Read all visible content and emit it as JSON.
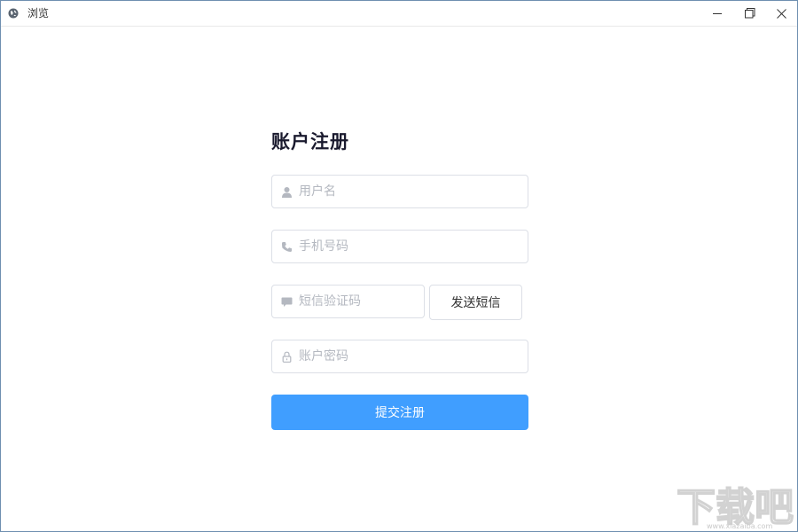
{
  "window": {
    "title": "浏览",
    "app_icon": "globe-icon",
    "controls": {
      "minimize_icon": "minimize-icon",
      "maximize_icon": "restore-icon",
      "close_icon": "close-icon"
    }
  },
  "form": {
    "title": "账户注册",
    "username": {
      "value": "",
      "placeholder": "用户名",
      "icon": "user-icon"
    },
    "phone": {
      "value": "",
      "placeholder": "手机号码",
      "icon": "phone-icon"
    },
    "sms_code": {
      "value": "",
      "placeholder": "短信验证码",
      "icon": "message-icon"
    },
    "send_sms_label": "发送短信",
    "password": {
      "value": "",
      "placeholder": "账户密码",
      "icon": "lock-icon"
    },
    "submit_label": "提交注册"
  },
  "watermark": {
    "text": "下载吧",
    "url": "www.xiazaiba.com"
  },
  "colors": {
    "primary": "#409eff",
    "border": "#dcdfe6",
    "placeholder": "#b4b8c0",
    "title": "#1a1a2e"
  }
}
